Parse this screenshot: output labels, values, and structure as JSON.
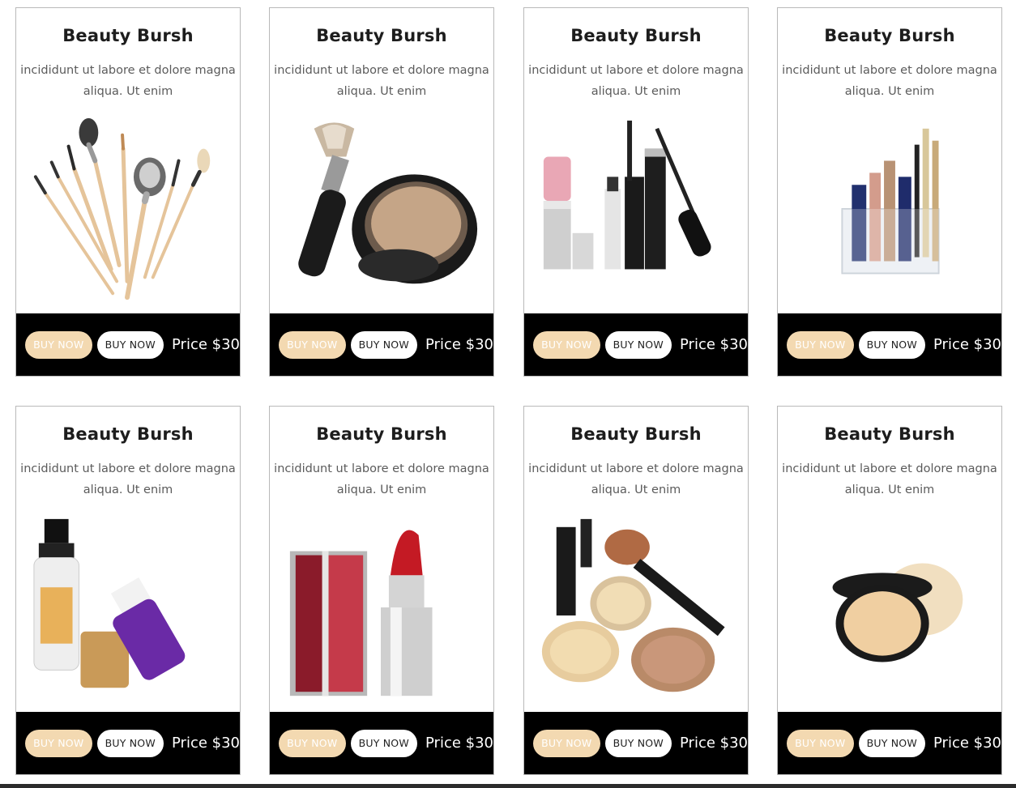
{
  "colors": {
    "card_bar": "#000000",
    "buy_now_primary_bg": "#f3d9b1",
    "buy_now_secondary_bg": "#ffffff"
  },
  "products": [
    {
      "title": "Beauty Bursh",
      "desc_line1": "incididunt ut labore et dolore magna",
      "desc_line2": "aliqua. Ut enim",
      "btn1": "BUY NOW",
      "btn2": "BUY NOW",
      "price": "Price $30",
      "image": "brush-set"
    },
    {
      "title": "Beauty Bursh",
      "desc_line1": "incididunt ut labore et dolore magna",
      "desc_line2": "aliqua. Ut enim",
      "btn1": "BUY NOW",
      "btn2": "BUY NOW",
      "price": "Price $30",
      "image": "brush-and-compact"
    },
    {
      "title": "Beauty Bursh",
      "desc_line1": "incididunt ut labore et dolore magna",
      "desc_line2": "aliqua. Ut enim",
      "btn1": "BUY NOW",
      "btn2": "BUY NOW",
      "price": "Price $30",
      "image": "mascara-set"
    },
    {
      "title": "Beauty Bursh",
      "desc_line1": "incididunt ut labore et dolore magna",
      "desc_line2": "aliqua. Ut enim",
      "btn1": "BUY NOW",
      "btn2": "BUY NOW",
      "price": "Price $30",
      "image": "makeup-organizer"
    },
    {
      "title": "Beauty Bursh",
      "desc_line1": "incididunt ut labore et dolore magna",
      "desc_line2": "aliqua. Ut enim",
      "btn1": "BUY NOW",
      "btn2": "BUY NOW",
      "price": "Price $30",
      "image": "spray-bottles"
    },
    {
      "title": "Beauty Bursh",
      "desc_line1": "incididunt ut labore et dolore magna",
      "desc_line2": "aliqua. Ut enim",
      "btn1": "BUY NOW",
      "btn2": "BUY NOW",
      "price": "Price $30",
      "image": "lipsticks"
    },
    {
      "title": "Beauty Bursh",
      "desc_line1": "incididunt ut labore et dolore magna",
      "desc_line2": "aliqua. Ut enim",
      "btn1": "BUY NOW",
      "btn2": "BUY NOW",
      "price": "Price $30",
      "image": "powder-kit"
    },
    {
      "title": "Beauty Bursh",
      "desc_line1": "incididunt ut labore et dolore magna",
      "desc_line2": "aliqua. Ut enim",
      "btn1": "BUY NOW",
      "btn2": "BUY NOW",
      "price": "Price $30",
      "image": "compact-powder"
    }
  ]
}
